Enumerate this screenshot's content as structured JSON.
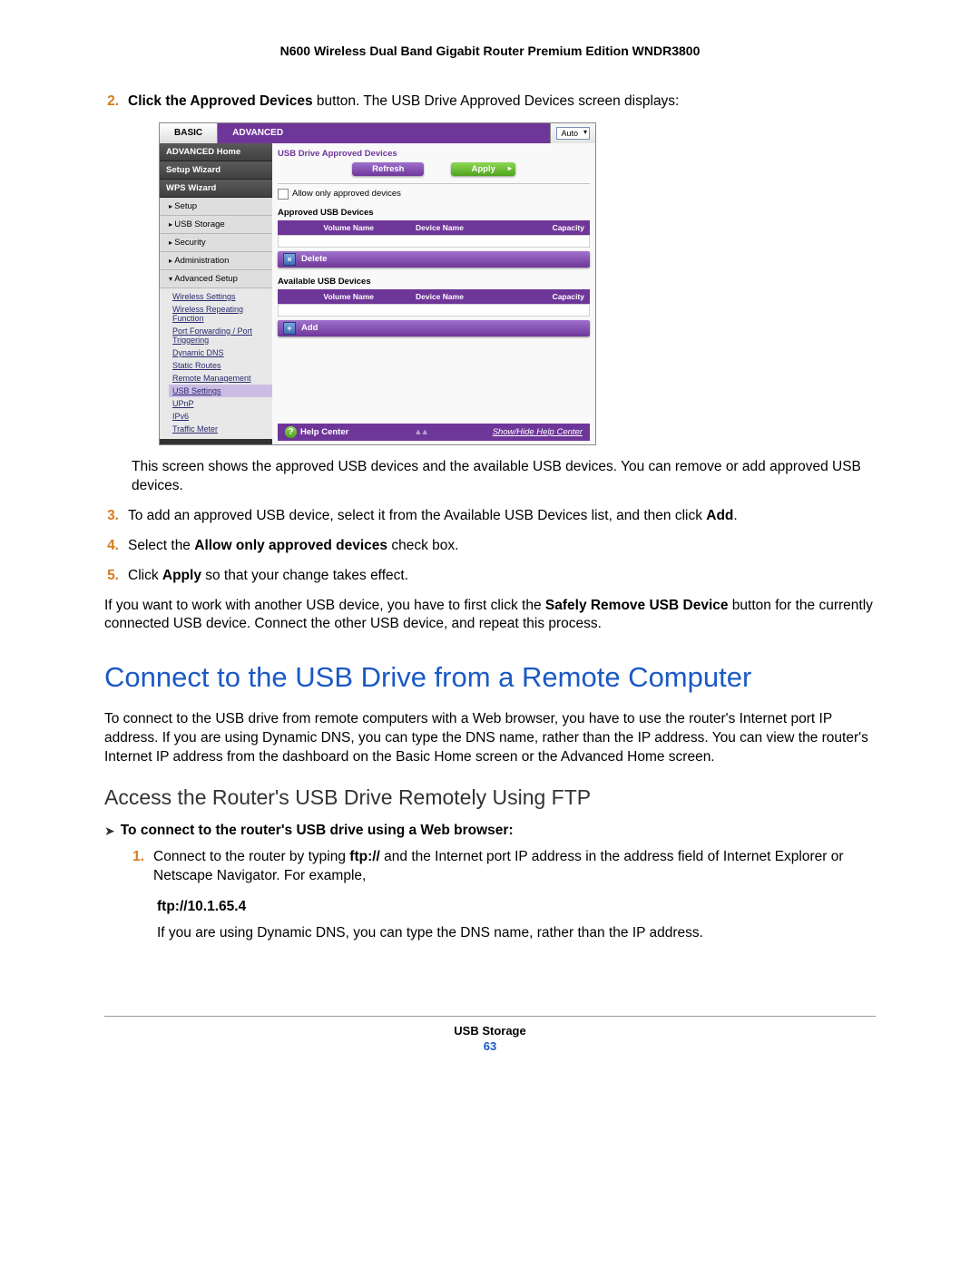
{
  "header": "N600 Wireless Dual Band Gigabit Router Premium Edition WNDR3800",
  "steps": {
    "s2_num": "2.",
    "s2_a": "Click the Approved Devices",
    "s2_b": " button. The USB Drive Approved Devices screen displays:",
    "s2_after": "This screen shows the approved USB devices and the available USB devices. You can remove or add approved USB devices.",
    "s3_num": "3.",
    "s3_a": "To add an approved USB device, select it from the Available USB Devices list, and then click ",
    "s3_b": "Add",
    "s3_c": ".",
    "s4_num": "4.",
    "s4_a": "Select the ",
    "s4_b": "Allow only approved devices",
    "s4_c": " check box.",
    "s5_num": "5.",
    "s5_a": "Click ",
    "s5_b": "Apply",
    "s5_c": " so that your change takes effect."
  },
  "note_a": "If you want to work with another USB device, you have to first click the ",
  "note_b": "Safely Remove USB Device",
  "note_c": " button for the currently connected USB device. Connect the other USB device, and repeat this process.",
  "h1": "Connect to the USB Drive from a Remote Computer",
  "h1_body": "To connect to the USB drive from remote computers with a Web browser, you have to use the router's Internet port IP address. If you are using Dynamic DNS, you can type the DNS name, rather than the IP address. You can view the router's Internet IP address from the dashboard on the Basic Home screen or the Advanced Home screen.",
  "h2": "Access the Router's USB Drive Remotely Using FTP",
  "proc": "To connect to the router's USB drive using a Web browser:",
  "p1_num": "1.",
  "p1_a": "Connect to the router by typing ",
  "p1_b": "ftp://",
  "p1_c": " and the Internet port IP address in the address field of Internet Explorer or Netscape Navigator. For example,",
  "ftp_example": "ftp://10.1.65.4",
  "ftp_after": "If you are using Dynamic DNS, you can type the DNS name, rather than the IP address.",
  "footer_title": "USB Storage",
  "footer_page": "63",
  "ui": {
    "tabs": {
      "basic": "BASIC",
      "advanced": "ADVANCED",
      "auto": "Auto"
    },
    "sidebar": {
      "home": "ADVANCED Home",
      "wizard": "Setup Wizard",
      "wps": "WPS Wizard",
      "setup": "Setup",
      "usb": "USB Storage",
      "security": "Security",
      "admin": "Administration",
      "advsetup": "Advanced Setup",
      "links": {
        "wireless": "Wireless Settings",
        "repeat": "Wireless Repeating Function",
        "portfwd": "Port Forwarding / Port Triggering",
        "ddns": "Dynamic DNS",
        "routes": "Static Routes",
        "remote": "Remote Management",
        "usbset": "USB Settings",
        "upnp": "UPnP",
        "ipv6": "IPv6",
        "traffic": "Traffic Meter"
      }
    },
    "content": {
      "title": "USB Drive Approved Devices",
      "refresh": "Refresh",
      "apply": "Apply",
      "allow": "Allow only approved devices",
      "approved": "Approved USB Devices",
      "available": "Available USB Devices",
      "th_volume": "Volume Name",
      "th_device": "Device Name",
      "th_capacity": "Capacity",
      "delete": "Delete",
      "add": "Add",
      "help": "Help Center",
      "showhide": "Show/Hide Help Center"
    }
  }
}
